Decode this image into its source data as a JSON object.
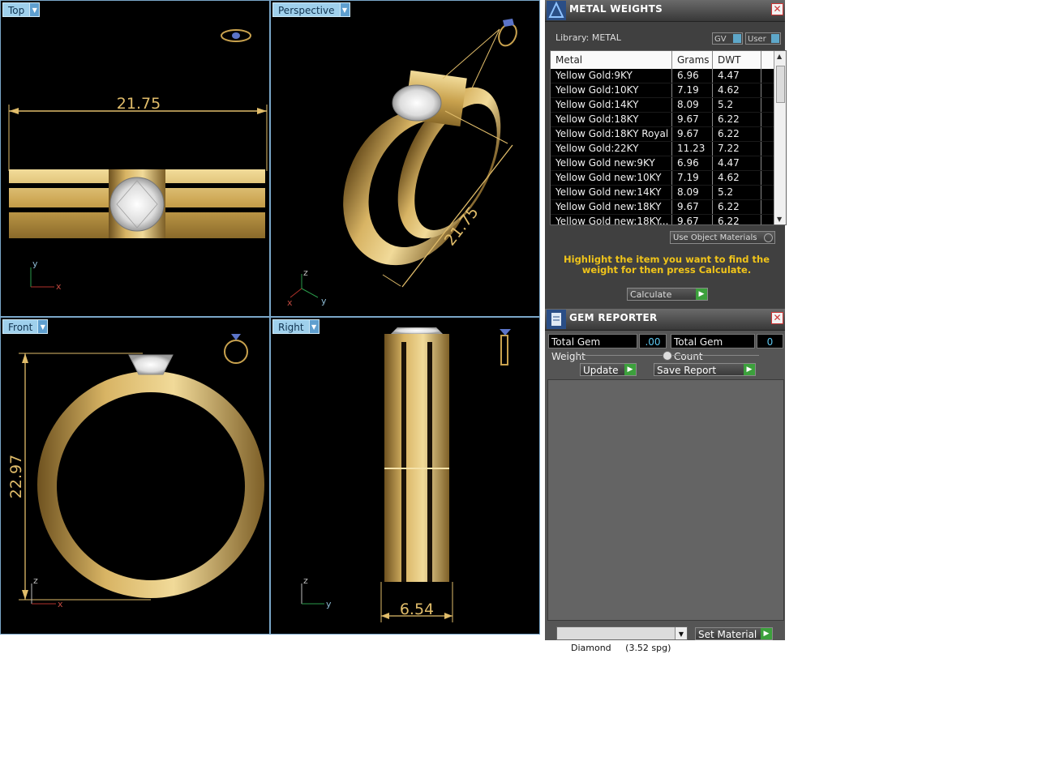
{
  "viewports": {
    "top": {
      "label": "Top",
      "dimension": "21.75"
    },
    "perspective": {
      "label": "Perspective",
      "dimension": "21.75"
    },
    "front": {
      "label": "Front",
      "dimension": "22.97"
    },
    "right": {
      "label": "Right",
      "dimension": "6.54"
    },
    "axes": {
      "x": "x",
      "y": "y",
      "z": "z"
    }
  },
  "metal_weights": {
    "title": "METAL WEIGHTS",
    "library_label": "Library: METAL",
    "gv_label": "GV",
    "user_label": "User",
    "columns": [
      "Metal",
      "Grams",
      "DWT"
    ],
    "rows": [
      [
        "Yellow Gold:9KY",
        "6.96",
        "4.47"
      ],
      [
        "Yellow Gold:10KY",
        "7.19",
        "4.62"
      ],
      [
        "Yellow Gold:14KY",
        "8.09",
        "5.2"
      ],
      [
        "Yellow Gold:18KY",
        "9.67",
        "6.22"
      ],
      [
        "Yellow Gold:18KY Royal",
        "9.67",
        "6.22"
      ],
      [
        "Yellow Gold:22KY",
        "11.23",
        "7.22"
      ],
      [
        "Yellow Gold new:9KY",
        "6.96",
        "4.47"
      ],
      [
        "Yellow Gold new:10KY",
        "7.19",
        "4.62"
      ],
      [
        "Yellow Gold new:14KY",
        "8.09",
        "5.2"
      ],
      [
        "Yellow Gold new:18KY",
        "9.67",
        "6.22"
      ],
      [
        "Yellow Gold new:18KY...",
        "9.67",
        "6.22"
      ]
    ],
    "use_object_materials": "Use Object Materials",
    "hint": "Highlight the item you want to find the weight for then press Calculate.",
    "calculate": "Calculate"
  },
  "gem_reporter": {
    "title": "GEM REPORTER",
    "total_weight_label": "Total Gem Weight",
    "total_weight_value": ".00",
    "total_count_label": "Total Gem Count",
    "total_count_value": "0",
    "update": "Update",
    "save_report": "Save Report",
    "material_select": "Diamond     (3.52 spg)",
    "set_material": "Set Material"
  },
  "colors": {
    "gold": "#c9a24e",
    "dim": "#e0bc6a",
    "accent_green": "#3ca03c",
    "hint_yellow": "#f0c41a"
  }
}
